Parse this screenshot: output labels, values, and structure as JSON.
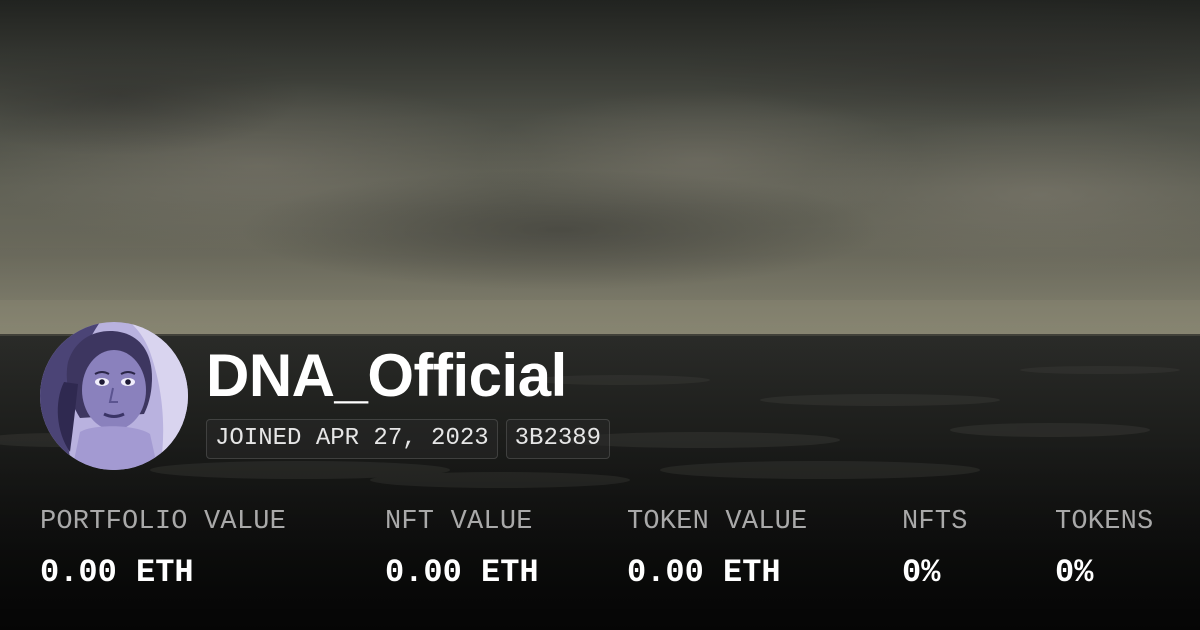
{
  "profile": {
    "username": "DNA_Official",
    "joined": "JOINED APR 27, 2023",
    "wallet_short": "3B2389"
  },
  "stats": [
    {
      "label": "PORTFOLIO VALUE",
      "value": "0.00 ETH"
    },
    {
      "label": "NFT VALUE",
      "value": "0.00 ETH"
    },
    {
      "label": "TOKEN VALUE",
      "value": "0.00 ETH"
    },
    {
      "label": "NFTS",
      "value": "0%"
    },
    {
      "label": "TOKENS",
      "value": "0%"
    }
  ],
  "colors": {
    "text_primary": "#ffffff",
    "text_muted": "#a9a9a9",
    "avatar_tint": "#8f86c4"
  },
  "icons": {
    "background": "stormy-seascape-image",
    "avatar": "profile-portrait-image"
  }
}
